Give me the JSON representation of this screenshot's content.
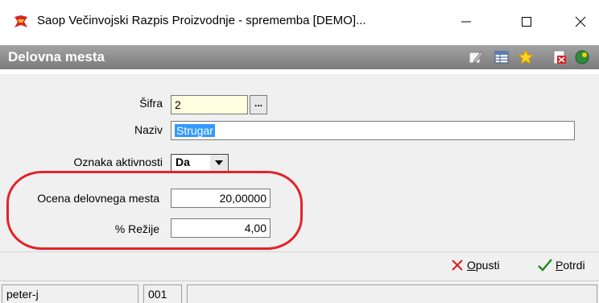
{
  "window": {
    "title": "Saop Večinvojski Razpis Proizvodnje - sprememba [DEMO]...",
    "minimize_icon": "minimize-icon",
    "maximize_icon": "maximize-icon",
    "close_icon": "close-icon"
  },
  "section": {
    "title": "Delovna mesta",
    "toolbar_icons": [
      "edit-icon",
      "table-view-icon",
      "favorite-star-icon",
      "delete-icon",
      "help-icon"
    ]
  },
  "form": {
    "sifra": {
      "label": "Šifra",
      "value": "2",
      "lookup_label": "..."
    },
    "naziv": {
      "label": "Naziv",
      "value": "Strugar"
    },
    "oznaka": {
      "label": "Oznaka aktivnosti",
      "value": "Da"
    },
    "ocena": {
      "label": "Ocena delovnega mesta",
      "value": "20,00000"
    },
    "rezije": {
      "label": "% Režije",
      "value": "4,00"
    }
  },
  "buttons": {
    "opusti": {
      "label": "Opusti",
      "accel": "O",
      "rest": "pusti"
    },
    "potrdi": {
      "label": "Potrdi",
      "accel": "P",
      "rest": "otrdi"
    }
  },
  "status": {
    "user": "peter-j",
    "code": "001",
    "extra": ""
  },
  "colors": {
    "highlight": "#e0242a",
    "section_bar": "#8c8c8c",
    "selection": "#3399ff"
  }
}
